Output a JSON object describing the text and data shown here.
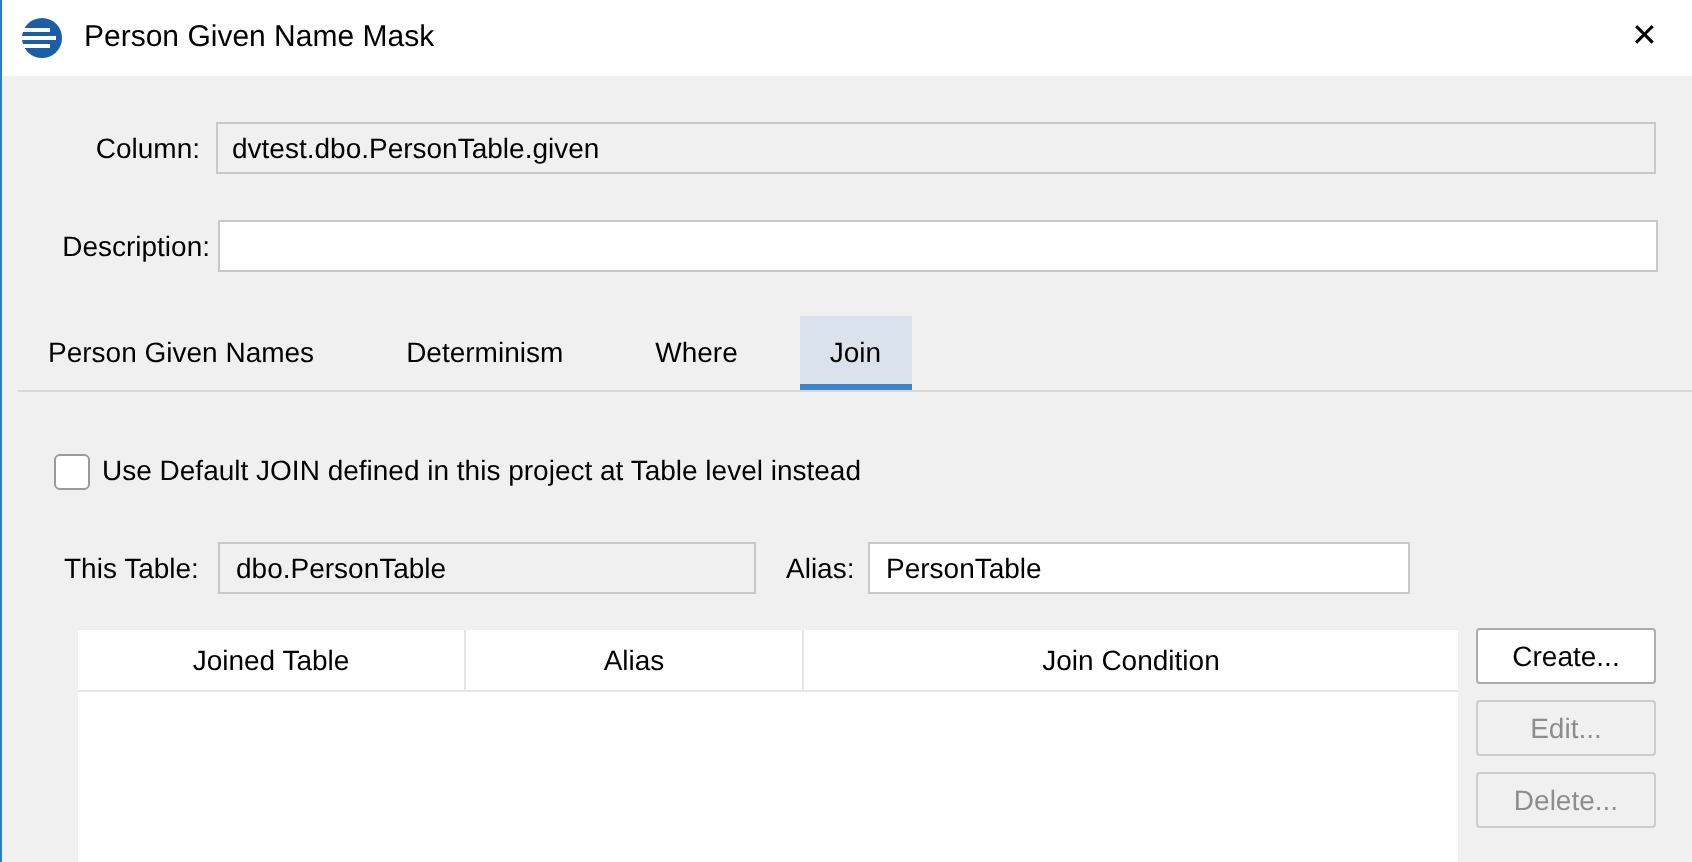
{
  "window": {
    "title": "Person Given Name Mask",
    "close": "✕"
  },
  "column": {
    "label": "Column:",
    "value": "dvtest.dbo.PersonTable.given"
  },
  "description": {
    "label": "Description:"
  },
  "tabs": [
    {
      "label": "Person Given Names",
      "selected": false
    },
    {
      "label": "Determinism",
      "selected": false
    },
    {
      "label": "Where",
      "selected": false
    },
    {
      "label": "Join",
      "selected": true
    }
  ],
  "use_default_join": {
    "label": "Use Default JOIN defined in this project at Table level instead",
    "checked": false
  },
  "this_table": {
    "label": "This Table:",
    "value": "dbo.PersonTable"
  },
  "alias": {
    "label": "Alias:",
    "value": "PersonTable"
  },
  "table": {
    "columns": [
      "Joined Table",
      "Alias",
      "Join Condition"
    ]
  },
  "buttons": [
    {
      "label": "Create...",
      "disabled": false
    },
    {
      "label": "Edit...",
      "disabled": true
    },
    {
      "label": "Delete...",
      "disabled": true
    }
  ]
}
